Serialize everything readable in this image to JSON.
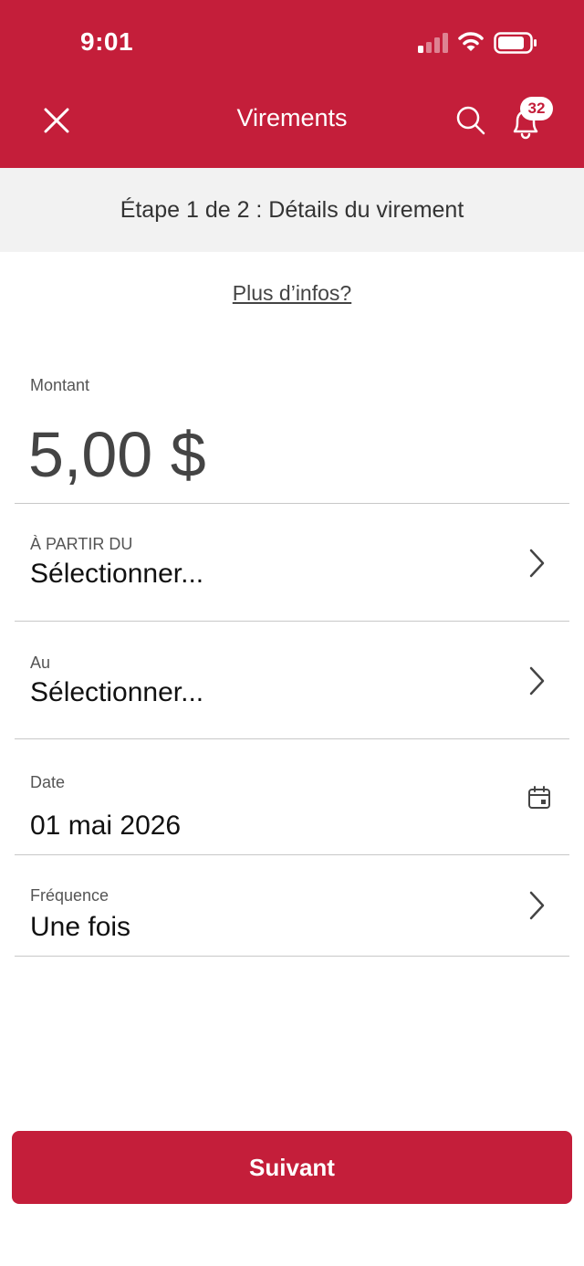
{
  "status_bar": {
    "time": "9:01",
    "signal_icon": "cellular-signal-icon",
    "wifi_icon": "wifi-icon",
    "battery_icon": "battery-icon"
  },
  "header": {
    "title": "Virements",
    "close_icon": "close-icon",
    "search_icon": "search-icon",
    "notification_icon": "bell-icon",
    "notification_count": "32",
    "background_color": "#c41e3a"
  },
  "step": {
    "text": "Étape 1 de 2 : Détails du virement"
  },
  "more_info": {
    "link": "Plus d’infos?"
  },
  "form": {
    "amount": {
      "label": "Montant",
      "value": "5,00 $"
    },
    "from": {
      "label": "À PARTIR DU",
      "value": "Sélectionner..."
    },
    "to": {
      "label": "Au",
      "value": "Sélectionner..."
    },
    "date": {
      "label": "Date",
      "value": "01 mai 2026",
      "icon": "calendar-icon"
    },
    "frequency": {
      "label": "Fréquence",
      "value": "Une fois"
    }
  },
  "actions": {
    "next_label": "Suivant"
  }
}
